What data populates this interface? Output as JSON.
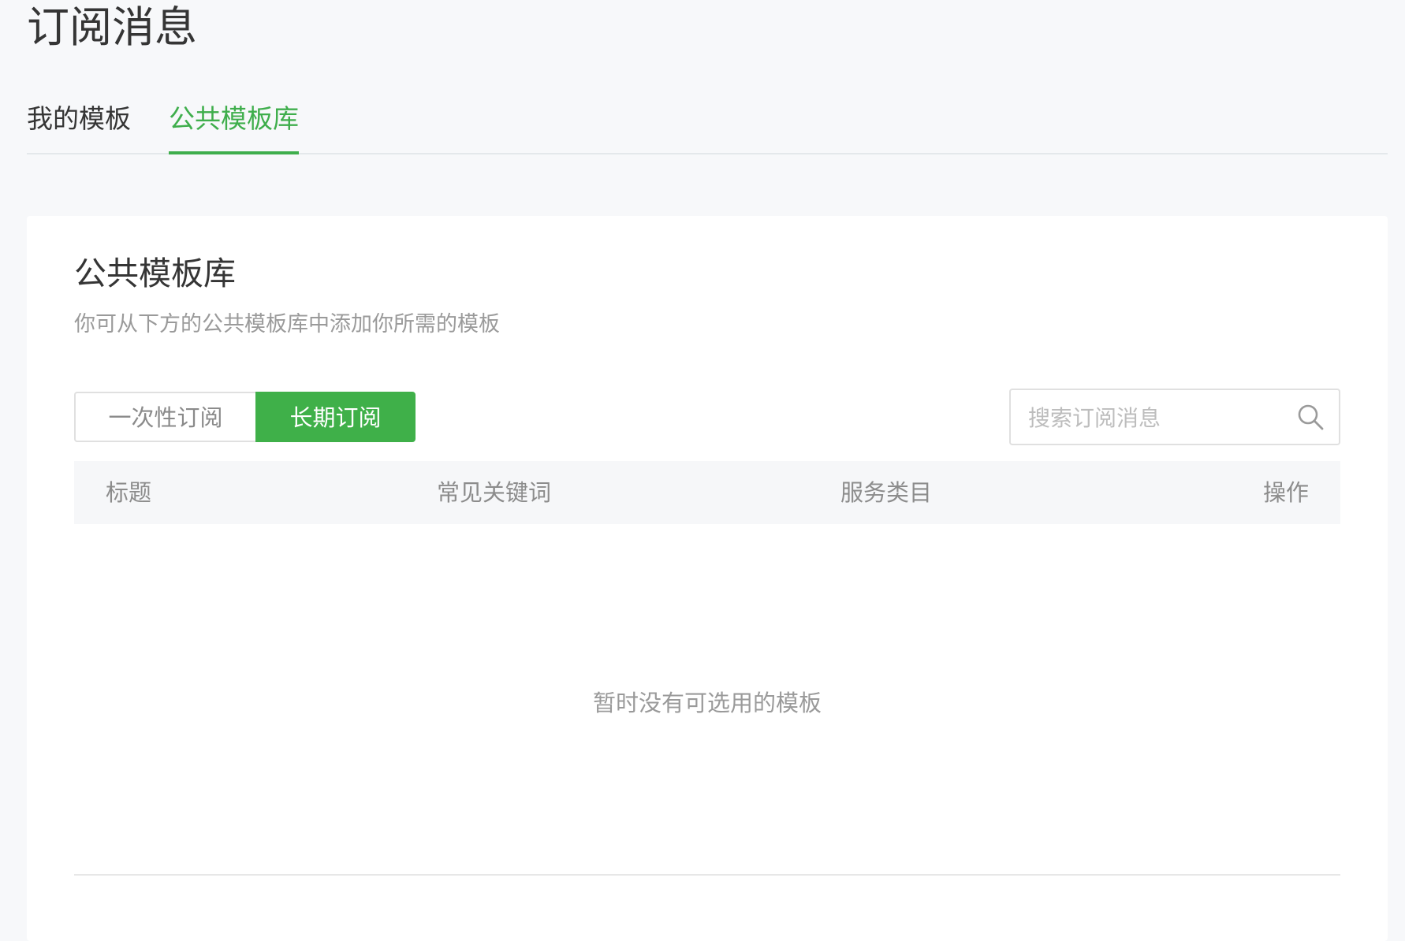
{
  "page": {
    "title": "订阅消息"
  },
  "tabs": [
    {
      "label": "我的模板",
      "active": false
    },
    {
      "label": "公共模板库",
      "active": true
    }
  ],
  "card": {
    "title": "公共模板库",
    "description": "你可从下方的公共模板库中添加你所需的模板"
  },
  "segmented": {
    "options": [
      {
        "label": "一次性订阅",
        "selected": false
      },
      {
        "label": "长期订阅",
        "selected": true
      }
    ]
  },
  "search": {
    "placeholder": "搜索订阅消息",
    "value": "",
    "icon": "search-icon"
  },
  "table": {
    "columns": [
      "标题",
      "常见关键词",
      "服务类目",
      "操作"
    ],
    "rows": [],
    "empty_text": "暂时没有可选用的模板"
  },
  "colors": {
    "accent": "#3fb049",
    "page_background": "#f7f8fa",
    "card_background": "#ffffff",
    "muted_text": "#9a9a9a"
  }
}
